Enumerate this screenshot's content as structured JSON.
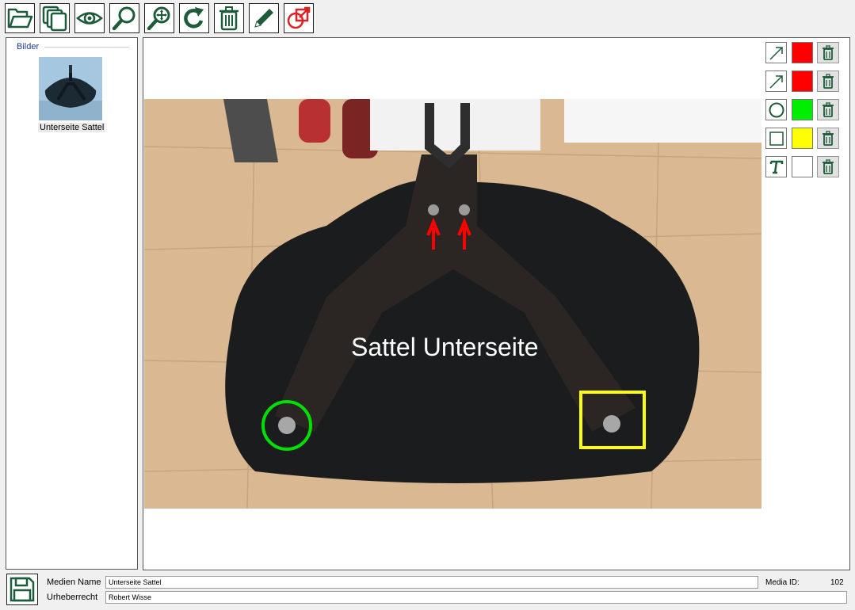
{
  "toolbar": {
    "buttons": [
      {
        "name": "open-folder-button",
        "icon": "folder-open-icon"
      },
      {
        "name": "copy-pages-button",
        "icon": "stacked-pages-icon"
      },
      {
        "name": "preview-button",
        "icon": "eye-icon"
      },
      {
        "name": "zoom-button",
        "icon": "magnifier-icon"
      },
      {
        "name": "zoom-fit-button",
        "icon": "magnifier-move-icon"
      },
      {
        "name": "rotate-button",
        "icon": "rotate-icon"
      },
      {
        "name": "delete-button",
        "icon": "trash-icon"
      },
      {
        "name": "edit-button",
        "icon": "pencil-icon"
      },
      {
        "name": "shapes-button",
        "icon": "shapes-icon"
      }
    ]
  },
  "sidebar": {
    "group_label": "Bilder",
    "items": [
      {
        "caption": "Unterseite Sattel"
      }
    ]
  },
  "canvas": {
    "annotation_text": "Sattel Unterseite"
  },
  "annotation_tools": [
    {
      "shape": "arrow-icon",
      "color": "#ff0000"
    },
    {
      "shape": "arrow-icon",
      "color": "#ff0000"
    },
    {
      "shape": "circle-icon",
      "color": "#00ee00"
    },
    {
      "shape": "rectangle-icon",
      "color": "#ffff00"
    },
    {
      "shape": "text-icon",
      "color": "#ffffff"
    }
  ],
  "form": {
    "medien_name_label": "Medien Name",
    "medien_name_value": "Unterseite Sattel",
    "urheberrecht_label": "Urheberrecht",
    "urheberrecht_value": "Robert Wisse",
    "media_id_label": "Media ID:",
    "media_id_value": "102"
  }
}
